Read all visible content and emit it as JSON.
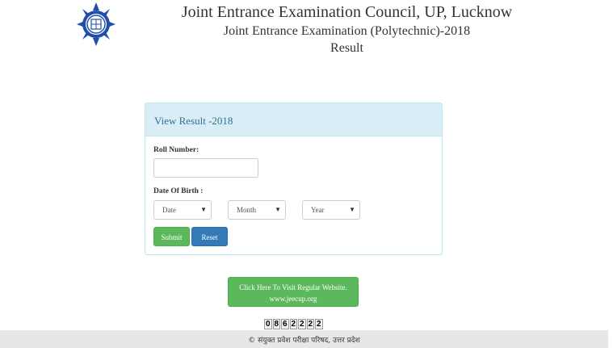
{
  "header": {
    "title": "Joint Entrance Examination Council, UP, Lucknow",
    "subtitle": "Joint Entrance Examination (Polytechnic)-2018",
    "page": "Result"
  },
  "panel": {
    "heading": "View Result -2018",
    "roll_label": "Roll Number:",
    "roll_value": "",
    "dob_label": "Date Of Birth :",
    "date_select": "Date",
    "month_select": "Month",
    "year_select": "Year",
    "submit_label": "Submit",
    "reset_label": "Reset"
  },
  "visit": {
    "line1": "Click Here To Visit Regular Website.",
    "line2": "www.jeecup.org"
  },
  "counter": [
    "0",
    "8",
    "6",
    "2",
    "2",
    "2",
    "2"
  ],
  "footer": "© संयुक्त प्रवेश परीक्षा परिषद, उत्तर प्रदेश",
  "colors": {
    "panel_heading_bg": "#d9edf7",
    "panel_border": "#bce8f1",
    "success": "#5cb85c",
    "primary": "#337ab7",
    "logo_blue": "#1f4fa8"
  }
}
